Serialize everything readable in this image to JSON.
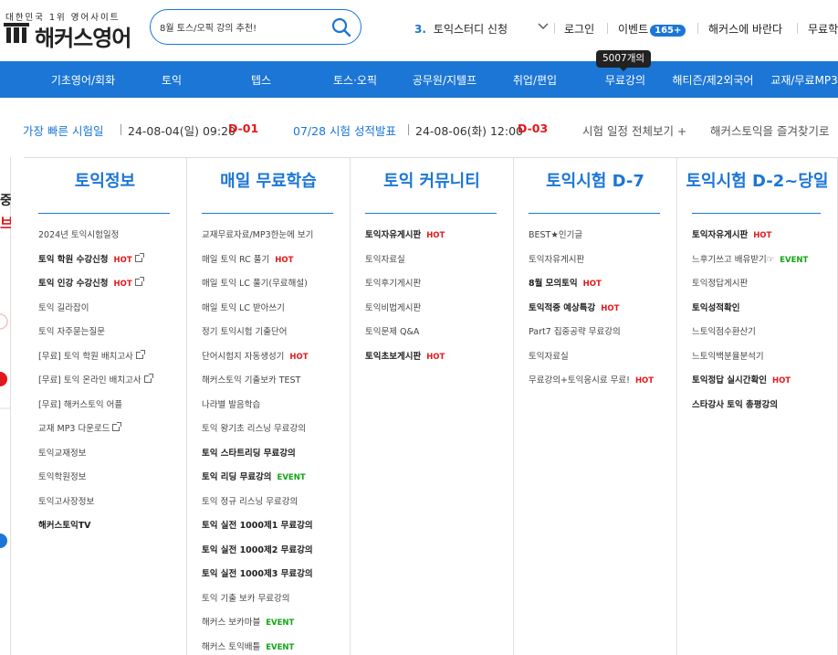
{
  "header": {
    "logo_tagline": "대한민국 1위 영어사이트",
    "logo_text": "해커스영어",
    "search": {
      "value": "8월 토스/오픽 강의 추천!"
    },
    "rolling_number": "3.",
    "rolling_text": "토익스터디 신청",
    "login": "로그인",
    "event_label": "이벤트",
    "event_count": "165+",
    "ask": "해커스에 바란다",
    "free": "무료학"
  },
  "gnb": {
    "items": [
      "기초영어/회화",
      "토익",
      "텝스",
      "토스·오픽",
      "공무원/지텔프",
      "취업/편입",
      "무료강의",
      "해티즌/제2외국어",
      "교재/무료MP3"
    ],
    "tooltip": "5007개의"
  },
  "schedule": {
    "earliest_label": "가장 빠른 시험일",
    "earliest_date": "24-08-04(일) 09:20",
    "earliest_d": "D-01",
    "result_label": "07/28 시험 성적발표",
    "result_date": "24-08-06(화) 12:00",
    "result_d": "D-03",
    "all_link": "시험 일정 전체보기 +",
    "favorite": "해커스토익을 즐겨찾기로"
  },
  "columns": [
    {
      "title": "토익정보",
      "links": [
        {
          "text": "2024년 토익시험일정",
          "bold": false,
          "tag": "",
          "ext": false
        },
        {
          "text": "토익 학원 수강신청",
          "bold": true,
          "tag": "HOT",
          "ext": true
        },
        {
          "text": "토익 인강 수강신청",
          "bold": true,
          "tag": "HOT",
          "ext": true
        },
        {
          "text": "토익 길라잡이",
          "bold": false,
          "tag": "",
          "ext": false
        },
        {
          "text": "토익 자주묻는질문",
          "bold": false,
          "tag": "",
          "ext": false
        },
        {
          "text": "[무료] 토익 학원 배치고사",
          "bold": false,
          "tag": "",
          "ext": true
        },
        {
          "text": "[무료] 토익 온라인 배치고사",
          "bold": false,
          "tag": "",
          "ext": true
        },
        {
          "text": "[무료] 해커스토익 어플",
          "bold": false,
          "tag": "",
          "ext": false
        },
        {
          "text": "교재 MP3 다운로드",
          "bold": false,
          "tag": "",
          "ext": true
        },
        {
          "text": "토익교재정보",
          "bold": false,
          "tag": "",
          "ext": false
        },
        {
          "text": "토익학원정보",
          "bold": false,
          "tag": "",
          "ext": false
        },
        {
          "text": "토익고사장정보",
          "bold": false,
          "tag": "",
          "ext": false
        },
        {
          "text": "해커스토익TV",
          "bold": true,
          "tag": "",
          "ext": false
        }
      ]
    },
    {
      "title": "매일 무료학습",
      "links": [
        {
          "text": "교재무료자료/MP3한눈에 보기",
          "bold": false,
          "tag": "",
          "ext": false
        },
        {
          "text": "매일 토익 RC 풀기",
          "bold": false,
          "tag": "HOT",
          "ext": false
        },
        {
          "text": "매일 토익 LC 풀기(무료해설)",
          "bold": false,
          "tag": "",
          "ext": false
        },
        {
          "text": "매일 토익 LC 받아쓰기",
          "bold": false,
          "tag": "",
          "ext": false
        },
        {
          "text": "정기 토익시험 기출단어",
          "bold": false,
          "tag": "",
          "ext": false
        },
        {
          "text": "단어시험지 자동생성기",
          "bold": false,
          "tag": "HOT",
          "ext": false
        },
        {
          "text": "해커스토익 기출보카 TEST",
          "bold": false,
          "tag": "",
          "ext": false
        },
        {
          "text": "나라별 발음학습",
          "bold": false,
          "tag": "",
          "ext": false
        },
        {
          "text": "토익 왕기초 리스닝 무료강의",
          "bold": false,
          "tag": "",
          "ext": false
        },
        {
          "text": "토익 스타트리딩 무료강의",
          "bold": true,
          "tag": "",
          "ext": false
        },
        {
          "text": "토익 리딩 무료강의",
          "bold": true,
          "tag": "EVENT",
          "ext": false
        },
        {
          "text": "토익 정규 리스닝 무료강의",
          "bold": false,
          "tag": "",
          "ext": false
        },
        {
          "text": "토익 실전 1000제1 무료강의",
          "bold": true,
          "tag": "",
          "ext": false
        },
        {
          "text": "토익 실전 1000제2 무료강의",
          "bold": true,
          "tag": "",
          "ext": false
        },
        {
          "text": "토익 실전 1000제3 무료강의",
          "bold": true,
          "tag": "",
          "ext": false
        },
        {
          "text": "토익 기출 보카 무료강의",
          "bold": false,
          "tag": "",
          "ext": false
        },
        {
          "text": "해커스 보카마블",
          "bold": false,
          "tag": "EVENT",
          "ext": false
        },
        {
          "text": "해커스 토익배틀",
          "bold": false,
          "tag": "EVENT",
          "ext": false
        }
      ]
    },
    {
      "title": "토익 커뮤니티",
      "links": [
        {
          "text": "토익자유게시판",
          "bold": true,
          "tag": "HOT",
          "ext": false
        },
        {
          "text": "토익자료실",
          "bold": false,
          "tag": "",
          "ext": false
        },
        {
          "text": "토익후기게시판",
          "bold": false,
          "tag": "",
          "ext": false
        },
        {
          "text": "토익비법게시판",
          "bold": false,
          "tag": "",
          "ext": false
        },
        {
          "text": "토익문제 Q&A",
          "bold": false,
          "tag": "",
          "ext": false
        },
        {
          "text": "토익초보게시판",
          "bold": true,
          "tag": "HOT",
          "ext": false
        }
      ]
    },
    {
      "title": "토익시험 D-7",
      "links": [
        {
          "text": "BEST★인기글",
          "bold": false,
          "tag": "",
          "ext": false
        },
        {
          "text": "토익자유게시판",
          "bold": false,
          "tag": "",
          "ext": false
        },
        {
          "text": "8월 모의토익",
          "bold": true,
          "tag": "HOT",
          "ext": false
        },
        {
          "text": "토익적중 예상특강",
          "bold": true,
          "tag": "HOT",
          "ext": false
        },
        {
          "text": "Part7 집중공략 무료강의",
          "bold": false,
          "tag": "",
          "ext": false
        },
        {
          "text": "토익자료실",
          "bold": false,
          "tag": "",
          "ext": false
        },
        {
          "text": "무료강의+토익응시료 무료!",
          "bold": false,
          "tag": "HOT",
          "ext": false
        }
      ]
    },
    {
      "title": "토익시험 D-2~당일",
      "links": [
        {
          "text": "토익자유게시판",
          "bold": true,
          "tag": "HOT",
          "ext": false
        },
        {
          "text": "느후기쓰고 배유받기☞",
          "bold": false,
          "tag": "EVENT",
          "ext": false
        },
        {
          "text": "토익정답게시판",
          "bold": false,
          "tag": "",
          "ext": false
        },
        {
          "text": "토익성적확인",
          "bold": true,
          "tag": "",
          "ext": false
        },
        {
          "text": "느토익점수환산기",
          "bold": false,
          "tag": "",
          "ext": false
        },
        {
          "text": "느토익백분율분석기",
          "bold": false,
          "tag": "",
          "ext": false
        },
        {
          "text": "토익정답 실시간확인",
          "bold": true,
          "tag": "HOT",
          "ext": false
        },
        {
          "text": "스타강사 토익 총평강의",
          "bold": true,
          "tag": "",
          "ext": false
        }
      ]
    }
  ]
}
